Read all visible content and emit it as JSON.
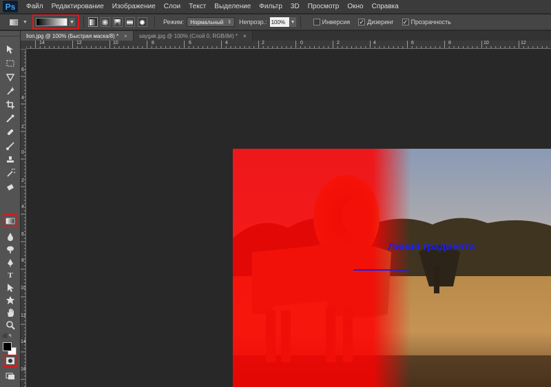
{
  "app": {
    "logo": "Ps"
  },
  "menu": [
    "Файл",
    "Редактирование",
    "Изображение",
    "Слои",
    "Текст",
    "Выделение",
    "Фильтр",
    "3D",
    "Просмотр",
    "Окно",
    "Справка"
  ],
  "options": {
    "mode_label": "Режим:",
    "mode_value": "Нормальный",
    "opacity_label": "Непрозр.:",
    "opacity_value": "100%",
    "inverse_label": "Инверсия",
    "dither_label": "Дизеринг",
    "transparency_label": "Прозрачность",
    "inverse_checked": false,
    "dither_checked": true,
    "transparency_checked": true
  },
  "tabs": [
    {
      "label": "lion.jpg @ 100% (Быстрая маска/8) *",
      "close": "×",
      "active": true
    },
    {
      "label": "saygak.jpg @ 100% (Слой 0, RGB/8#) *",
      "close": "×",
      "active": false
    }
  ],
  "ruler_top": [
    "14",
    "12",
    "10",
    "8",
    "6",
    "4",
    "2",
    "0",
    "2",
    "4",
    "6",
    "8",
    "10",
    "12"
  ],
  "ruler_left": [
    "6",
    "4",
    "2",
    "0",
    "2",
    "4",
    "6",
    "8",
    "10",
    "12",
    "14",
    "16"
  ],
  "annotation": {
    "text": "Линия градиента"
  },
  "colors": {
    "highlight": "#e0171c",
    "annotation": "#1e1ef0",
    "mask_red": "#ff0000"
  },
  "icons": {
    "tools": [
      "move-icon",
      "marquee-icon",
      "lasso-icon",
      "magic-wand-icon",
      "crop-icon",
      "eyedropper-icon",
      "healing-icon",
      "brush-icon",
      "stamp-icon",
      "history-brush-icon",
      "eraser-icon",
      "gradient-icon",
      "blur-icon",
      "dodge-icon",
      "pen-icon",
      "type-icon",
      "path-select-icon",
      "shape-icon",
      "hand-icon",
      "zoom-icon",
      "quick-mask-icon",
      "screen-mode-icon"
    ]
  }
}
